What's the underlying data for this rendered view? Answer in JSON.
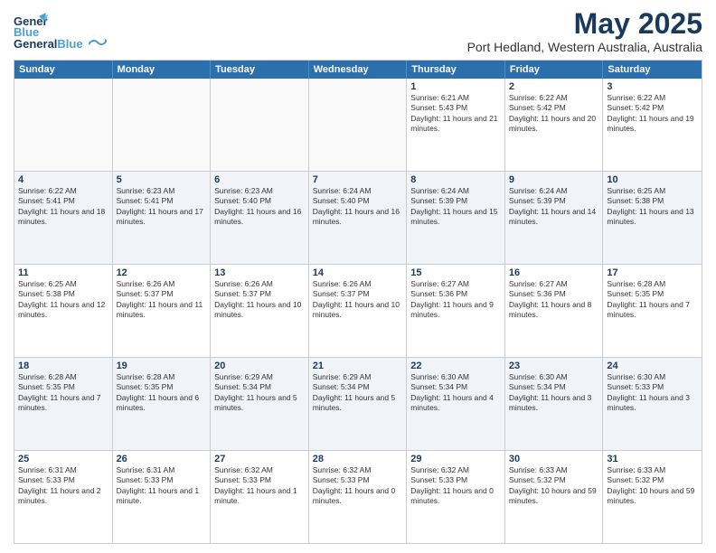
{
  "header": {
    "logo_general": "General",
    "logo_blue": "Blue",
    "month_title": "May 2025",
    "location": "Port Hedland, Western Australia, Australia"
  },
  "weekdays": [
    "Sunday",
    "Monday",
    "Tuesday",
    "Wednesday",
    "Thursday",
    "Friday",
    "Saturday"
  ],
  "rows": [
    [
      {
        "day": "",
        "empty": true
      },
      {
        "day": "",
        "empty": true
      },
      {
        "day": "",
        "empty": true
      },
      {
        "day": "",
        "empty": true
      },
      {
        "day": "1",
        "sunrise": "6:21 AM",
        "sunset": "5:43 PM",
        "daylight": "11 hours and 21 minutes."
      },
      {
        "day": "2",
        "sunrise": "6:22 AM",
        "sunset": "5:42 PM",
        "daylight": "11 hours and 20 minutes."
      },
      {
        "day": "3",
        "sunrise": "6:22 AM",
        "sunset": "5:42 PM",
        "daylight": "11 hours and 19 minutes."
      }
    ],
    [
      {
        "day": "4",
        "sunrise": "6:22 AM",
        "sunset": "5:41 PM",
        "daylight": "11 hours and 18 minutes."
      },
      {
        "day": "5",
        "sunrise": "6:23 AM",
        "sunset": "5:41 PM",
        "daylight": "11 hours and 17 minutes."
      },
      {
        "day": "6",
        "sunrise": "6:23 AM",
        "sunset": "5:40 PM",
        "daylight": "11 hours and 16 minutes."
      },
      {
        "day": "7",
        "sunrise": "6:24 AM",
        "sunset": "5:40 PM",
        "daylight": "11 hours and 16 minutes."
      },
      {
        "day": "8",
        "sunrise": "6:24 AM",
        "sunset": "5:39 PM",
        "daylight": "11 hours and 15 minutes."
      },
      {
        "day": "9",
        "sunrise": "6:24 AM",
        "sunset": "5:39 PM",
        "daylight": "11 hours and 14 minutes."
      },
      {
        "day": "10",
        "sunrise": "6:25 AM",
        "sunset": "5:38 PM",
        "daylight": "11 hours and 13 minutes."
      }
    ],
    [
      {
        "day": "11",
        "sunrise": "6:25 AM",
        "sunset": "5:38 PM",
        "daylight": "11 hours and 12 minutes."
      },
      {
        "day": "12",
        "sunrise": "6:26 AM",
        "sunset": "5:37 PM",
        "daylight": "11 hours and 11 minutes."
      },
      {
        "day": "13",
        "sunrise": "6:26 AM",
        "sunset": "5:37 PM",
        "daylight": "11 hours and 10 minutes."
      },
      {
        "day": "14",
        "sunrise": "6:26 AM",
        "sunset": "5:37 PM",
        "daylight": "11 hours and 10 minutes."
      },
      {
        "day": "15",
        "sunrise": "6:27 AM",
        "sunset": "5:36 PM",
        "daylight": "11 hours and 9 minutes."
      },
      {
        "day": "16",
        "sunrise": "6:27 AM",
        "sunset": "5:36 PM",
        "daylight": "11 hours and 8 minutes."
      },
      {
        "day": "17",
        "sunrise": "6:28 AM",
        "sunset": "5:35 PM",
        "daylight": "11 hours and 7 minutes."
      }
    ],
    [
      {
        "day": "18",
        "sunrise": "6:28 AM",
        "sunset": "5:35 PM",
        "daylight": "11 hours and 7 minutes."
      },
      {
        "day": "19",
        "sunrise": "6:28 AM",
        "sunset": "5:35 PM",
        "daylight": "11 hours and 6 minutes."
      },
      {
        "day": "20",
        "sunrise": "6:29 AM",
        "sunset": "5:34 PM",
        "daylight": "11 hours and 5 minutes."
      },
      {
        "day": "21",
        "sunrise": "6:29 AM",
        "sunset": "5:34 PM",
        "daylight": "11 hours and 5 minutes."
      },
      {
        "day": "22",
        "sunrise": "6:30 AM",
        "sunset": "5:34 PM",
        "daylight": "11 hours and 4 minutes."
      },
      {
        "day": "23",
        "sunrise": "6:30 AM",
        "sunset": "5:34 PM",
        "daylight": "11 hours and 3 minutes."
      },
      {
        "day": "24",
        "sunrise": "6:30 AM",
        "sunset": "5:33 PM",
        "daylight": "11 hours and 3 minutes."
      }
    ],
    [
      {
        "day": "25",
        "sunrise": "6:31 AM",
        "sunset": "5:33 PM",
        "daylight": "11 hours and 2 minutes."
      },
      {
        "day": "26",
        "sunrise": "6:31 AM",
        "sunset": "5:33 PM",
        "daylight": "11 hours and 1 minute."
      },
      {
        "day": "27",
        "sunrise": "6:32 AM",
        "sunset": "5:33 PM",
        "daylight": "11 hours and 1 minute."
      },
      {
        "day": "28",
        "sunrise": "6:32 AM",
        "sunset": "5:33 PM",
        "daylight": "11 hours and 0 minutes."
      },
      {
        "day": "29",
        "sunrise": "6:32 AM",
        "sunset": "5:33 PM",
        "daylight": "11 hours and 0 minutes."
      },
      {
        "day": "30",
        "sunrise": "6:33 AM",
        "sunset": "5:32 PM",
        "daylight": "10 hours and 59 minutes."
      },
      {
        "day": "31",
        "sunrise": "6:33 AM",
        "sunset": "5:32 PM",
        "daylight": "10 hours and 59 minutes."
      }
    ]
  ]
}
